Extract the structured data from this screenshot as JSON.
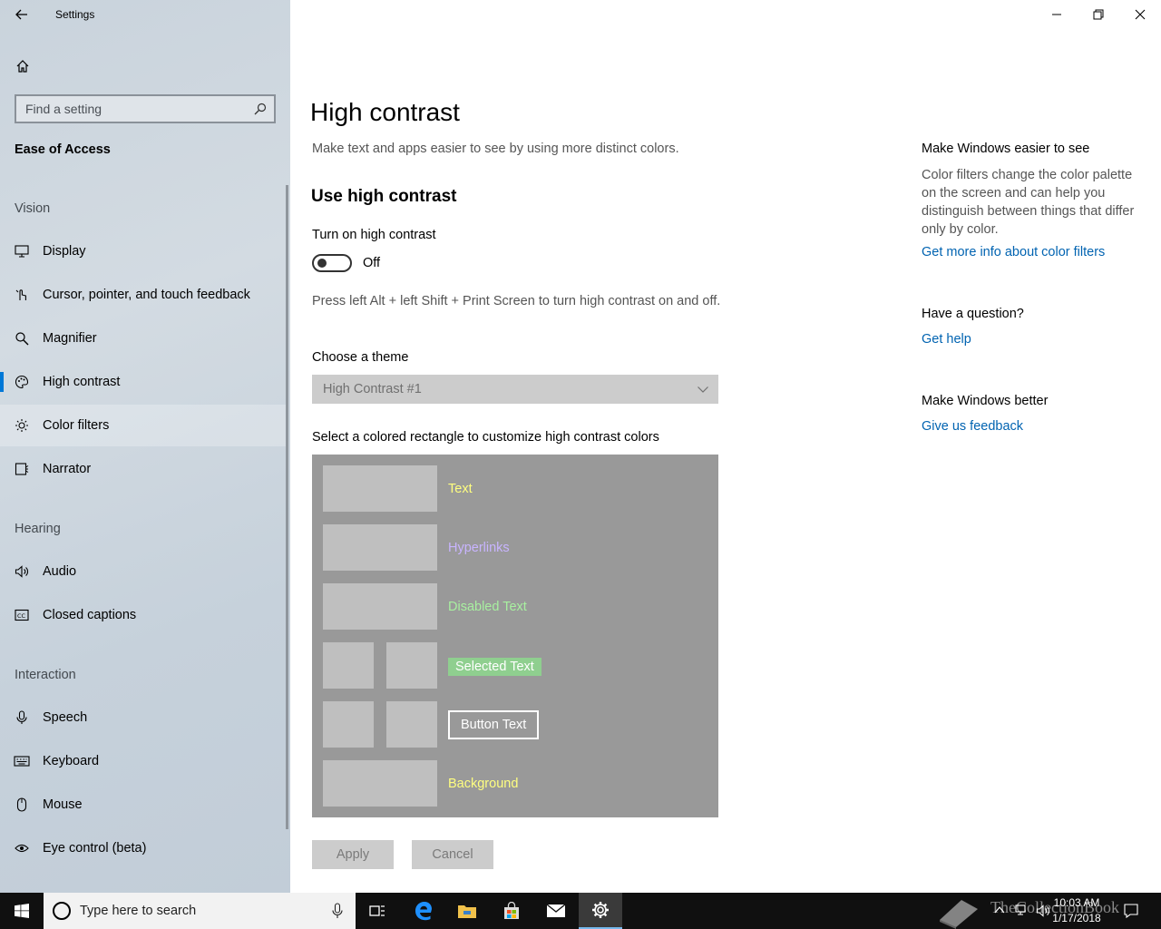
{
  "window": {
    "title": "Settings"
  },
  "sidebar": {
    "search_placeholder": "Find a setting",
    "section_title": "Ease of Access",
    "groups": {
      "vision": "Vision",
      "hearing": "Hearing",
      "interaction": "Interaction"
    },
    "items": {
      "display": "Display",
      "cursor": "Cursor, pointer, and touch feedback",
      "magnifier": "Magnifier",
      "high_contrast": "High contrast",
      "color_filters": "Color filters",
      "narrator": "Narrator",
      "audio": "Audio",
      "closed_captions": "Closed captions",
      "speech": "Speech",
      "keyboard": "Keyboard",
      "mouse": "Mouse",
      "eye_control": "Eye control (beta)"
    },
    "selected": "high_contrast"
  },
  "main": {
    "title": "High contrast",
    "description": "Make text and apps easier to see by using more distinct colors.",
    "subheading": "Use high contrast",
    "toggle_label": "Turn on high contrast",
    "toggle_state": "Off",
    "toggle_on": false,
    "shortcut_hint": "Press left Alt + left Shift + Print Screen to turn high contrast on and off.",
    "theme_label": "Choose a theme",
    "theme_value": "High Contrast #1",
    "rect_label": "Select a colored rectangle to customize high contrast colors",
    "preview": {
      "text": "Text",
      "hyperlinks": "Hyperlinks",
      "disabled_text": "Disabled Text",
      "selected_text": "Selected Text",
      "button_text": "Button Text",
      "background": "Background"
    },
    "apply": "Apply",
    "cancel": "Cancel"
  },
  "right": {
    "head1": "Make Windows easier to see",
    "text1": "Color filters change the color palette on the screen and can help you distinguish between things that differ only by color.",
    "link1": "Get more info about color filters",
    "head2": "Have a question?",
    "link2": "Get help",
    "head3": "Make Windows better",
    "link3": "Give us feedback"
  },
  "taskbar": {
    "search_text": "Type here to search",
    "time": "10:03 AM",
    "date": "1/17/2018",
    "watermark": "TheCollectionBook"
  },
  "colors": {
    "accent": "#0078d7",
    "link": "#0063b1",
    "preview_text": "#ffff80",
    "preview_hyperlink": "#c8b4ff",
    "preview_disabled": "#a8f0a0",
    "preview_background_label": "#ffff80"
  }
}
